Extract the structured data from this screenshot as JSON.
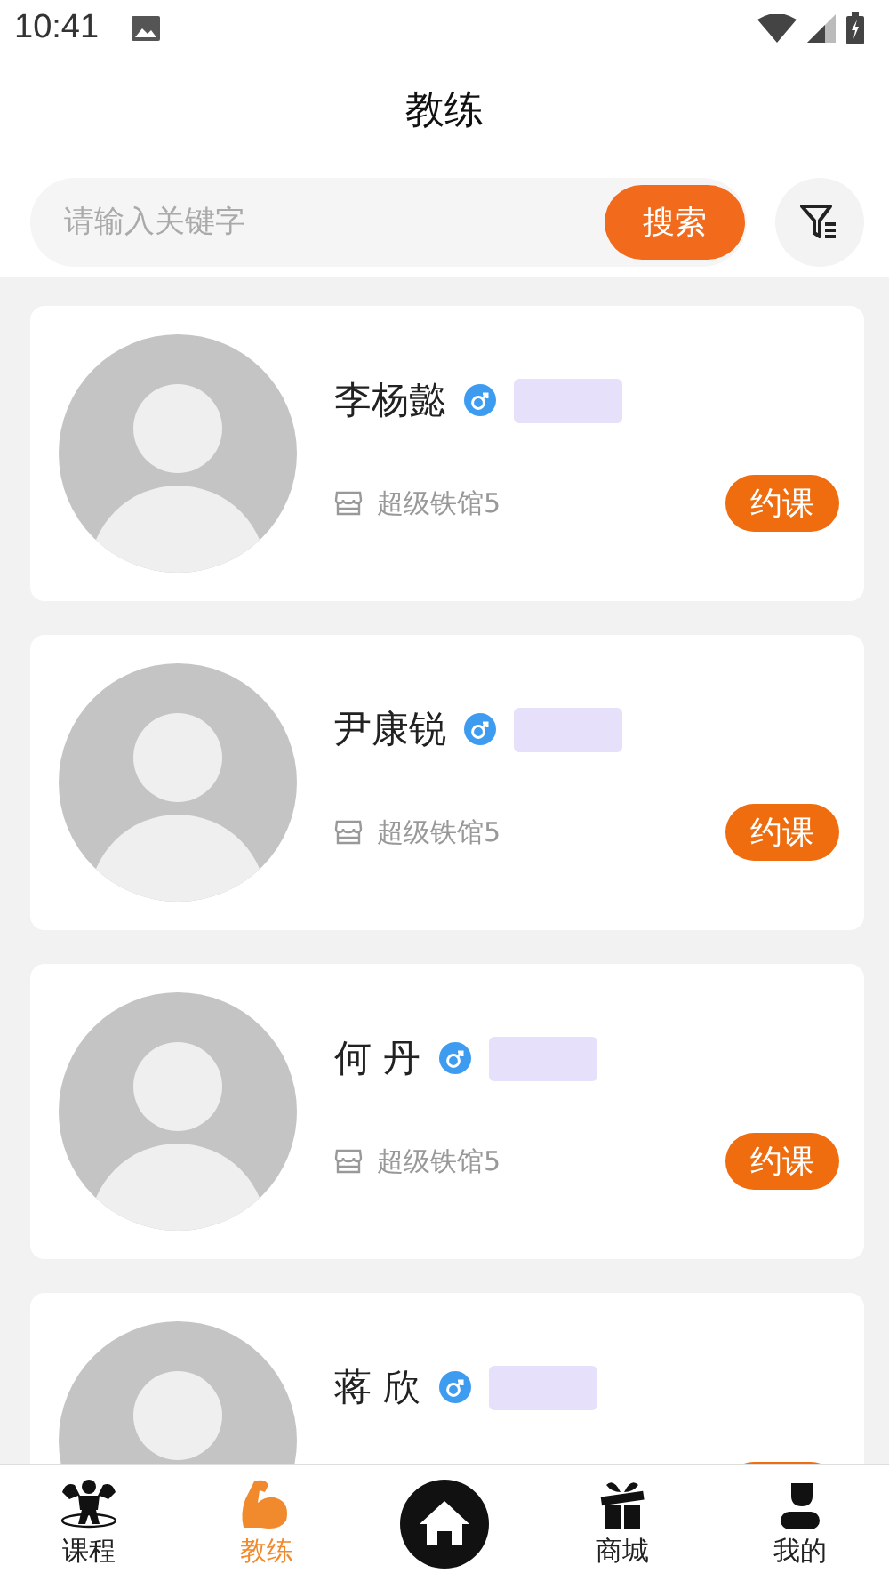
{
  "status_bar": {
    "time": "10:41"
  },
  "header": {
    "title": "教练"
  },
  "search": {
    "placeholder": "请输入关键字",
    "button": "搜索"
  },
  "coaches": [
    {
      "name": "李杨懿",
      "kind": "male",
      "venue": "超级铁馆5",
      "action": "约课"
    },
    {
      "name": "尹康锐",
      "kind": "male",
      "venue": "超级铁馆5",
      "action": "约课"
    },
    {
      "name": "何 丹",
      "kind": "male",
      "venue": "超级铁馆5",
      "action": "约课"
    },
    {
      "name": "蒋 欣",
      "kind": "male"
    }
  ],
  "nav": [
    {
      "kind": "course",
      "label": "课程",
      "selected": false
    },
    {
      "kind": "coach",
      "label": "教练",
      "selected": true
    },
    {
      "kind": "home"
    },
    {
      "kind": "shop",
      "label": "商城",
      "selected": false
    },
    {
      "kind": "me",
      "label": "我的",
      "selected": false
    }
  ]
}
